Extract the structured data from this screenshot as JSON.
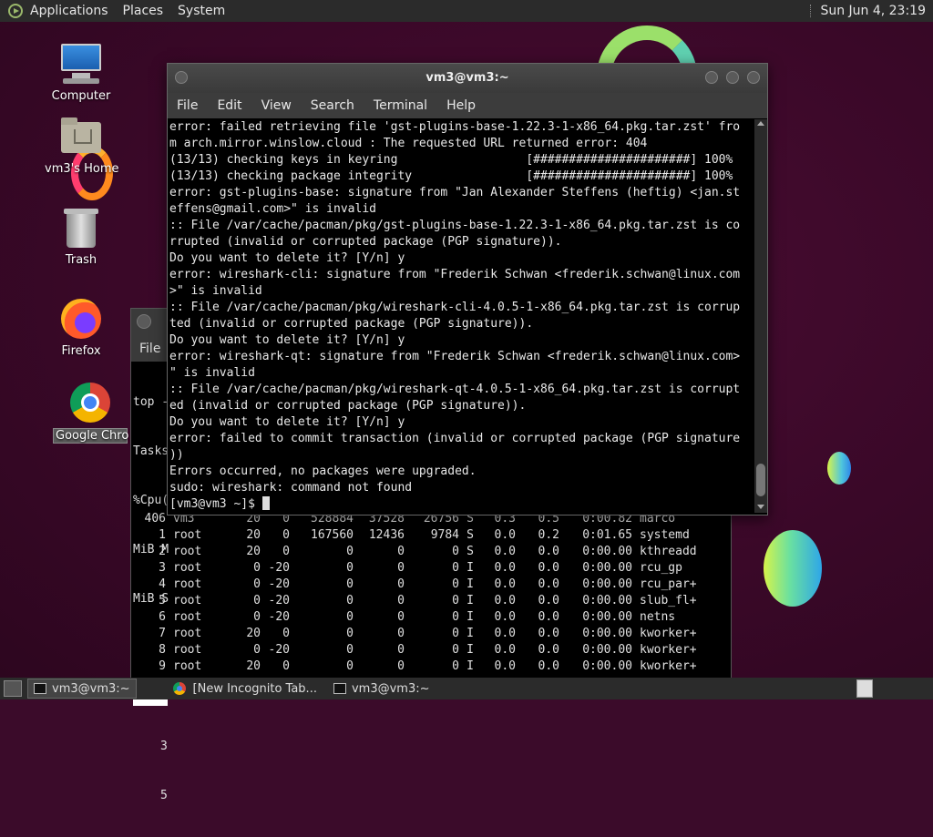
{
  "top_panel": {
    "menus": [
      "Applications",
      "Places",
      "System"
    ],
    "clock": "Sun Jun  4, 23:19"
  },
  "desktop_icons": [
    {
      "label": "Computer",
      "icon": "computer-icon"
    },
    {
      "label": "vm3's Home",
      "icon": "home-folder-icon"
    },
    {
      "label": "Trash",
      "icon": "trash-icon"
    },
    {
      "label": "Firefox",
      "icon": "firefox-icon"
    },
    {
      "label": "Google Chro",
      "icon": "chrome-icon"
    }
  ],
  "top_window": {
    "menu_file": "File",
    "header_lines": [
      "top -",
      "Tasks",
      "%Cpu(",
      "MiB M",
      "MiB S",
      "",
      "",
      "3",
      "5"
    ],
    "selected_row_prefix": "P",
    "processes": [
      {
        "pid": "406",
        "user": "vm3",
        "pr": "20",
        "ni": "0",
        "virt": "528884",
        "res": "37528",
        "shr": "26756",
        "s": "S",
        "cpu": "0.3",
        "mem": "0.5",
        "time": "0:00.82",
        "cmd": "marco"
      },
      {
        "pid": "1",
        "user": "root",
        "pr": "20",
        "ni": "0",
        "virt": "167560",
        "res": "12436",
        "shr": "9784",
        "s": "S",
        "cpu": "0.0",
        "mem": "0.2",
        "time": "0:01.65",
        "cmd": "systemd"
      },
      {
        "pid": "2",
        "user": "root",
        "pr": "20",
        "ni": "0",
        "virt": "0",
        "res": "0",
        "shr": "0",
        "s": "S",
        "cpu": "0.0",
        "mem": "0.0",
        "time": "0:00.00",
        "cmd": "kthreadd"
      },
      {
        "pid": "3",
        "user": "root",
        "pr": "0",
        "ni": "-20",
        "virt": "0",
        "res": "0",
        "shr": "0",
        "s": "I",
        "cpu": "0.0",
        "mem": "0.0",
        "time": "0:00.00",
        "cmd": "rcu_gp"
      },
      {
        "pid": "4",
        "user": "root",
        "pr": "0",
        "ni": "-20",
        "virt": "0",
        "res": "0",
        "shr": "0",
        "s": "I",
        "cpu": "0.0",
        "mem": "0.0",
        "time": "0:00.00",
        "cmd": "rcu_par+"
      },
      {
        "pid": "5",
        "user": "root",
        "pr": "0",
        "ni": "-20",
        "virt": "0",
        "res": "0",
        "shr": "0",
        "s": "I",
        "cpu": "0.0",
        "mem": "0.0",
        "time": "0:00.00",
        "cmd": "slub_fl+"
      },
      {
        "pid": "6",
        "user": "root",
        "pr": "0",
        "ni": "-20",
        "virt": "0",
        "res": "0",
        "shr": "0",
        "s": "I",
        "cpu": "0.0",
        "mem": "0.0",
        "time": "0:00.00",
        "cmd": "netns"
      },
      {
        "pid": "7",
        "user": "root",
        "pr": "20",
        "ni": "0",
        "virt": "0",
        "res": "0",
        "shr": "0",
        "s": "I",
        "cpu": "0.0",
        "mem": "0.0",
        "time": "0:00.00",
        "cmd": "kworker+"
      },
      {
        "pid": "8",
        "user": "root",
        "pr": "0",
        "ni": "-20",
        "virt": "0",
        "res": "0",
        "shr": "0",
        "s": "I",
        "cpu": "0.0",
        "mem": "0.0",
        "time": "0:00.00",
        "cmd": "kworker+"
      },
      {
        "pid": "9",
        "user": "root",
        "pr": "20",
        "ni": "0",
        "virt": "0",
        "res": "0",
        "shr": "0",
        "s": "I",
        "cpu": "0.0",
        "mem": "0.0",
        "time": "0:00.00",
        "cmd": "kworker+"
      }
    ]
  },
  "terminal": {
    "title": "vm3@vm3:~",
    "menus": [
      "File",
      "Edit",
      "View",
      "Search",
      "Terminal",
      "Help"
    ],
    "lines": [
      "error: failed retrieving file 'gst-plugins-base-1.22.3-1-x86_64.pkg.tar.zst' fro",
      "m arch.mirror.winslow.cloud : The requested URL returned error: 404",
      "(13/13) checking keys in keyring                  [######################] 100%",
      "(13/13) checking package integrity                [######################] 100%",
      "error: gst-plugins-base: signature from \"Jan Alexander Steffens (heftig) <jan.st",
      "effens@gmail.com>\" is invalid",
      ":: File /var/cache/pacman/pkg/gst-plugins-base-1.22.3-1-x86_64.pkg.tar.zst is co",
      "rrupted (invalid or corrupted package (PGP signature)).",
      "Do you want to delete it? [Y/n] y",
      "error: wireshark-cli: signature from \"Frederik Schwan <frederik.schwan@linux.com",
      ">\" is invalid",
      ":: File /var/cache/pacman/pkg/wireshark-cli-4.0.5-1-x86_64.pkg.tar.zst is corrup",
      "ted (invalid or corrupted package (PGP signature)).",
      "Do you want to delete it? [Y/n] y",
      "error: wireshark-qt: signature from \"Frederik Schwan <frederik.schwan@linux.com>",
      "\" is invalid",
      ":: File /var/cache/pacman/pkg/wireshark-qt-4.0.5-1-x86_64.pkg.tar.zst is corrupt",
      "ed (invalid or corrupted package (PGP signature)).",
      "Do you want to delete it? [Y/n] y",
      "error: failed to commit transaction (invalid or corrupted package (PGP signature",
      "))",
      "Errors occurred, no packages were upgraded.",
      "sudo: wireshark: command not found"
    ],
    "prompt": "[vm3@vm3 ~]$ "
  },
  "taskbar": {
    "tasks": [
      {
        "label": "vm3@vm3:~",
        "icon": "terminal-icon",
        "active": true
      },
      {
        "label": "[New Incognito Tab...",
        "icon": "chrome-icon",
        "active": false
      },
      {
        "label": "vm3@vm3:~",
        "icon": "terminal-icon",
        "active": false
      }
    ]
  }
}
